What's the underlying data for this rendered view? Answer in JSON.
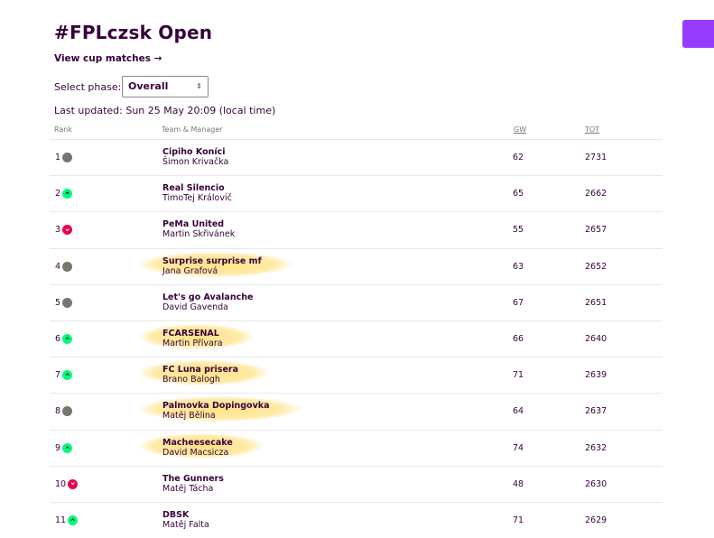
{
  "page": {
    "title": "#FPLczsk Open",
    "cup_link": "View cup matches →",
    "phase_label": "Select phase:",
    "phase_value": "Overall",
    "last_updated": "Last updated: Sun 25 May 20:09 (local time)"
  },
  "colors": {
    "primary": "#37003c",
    "accent": "#963cff",
    "up": "#01fc7a",
    "down": "#e90052",
    "same": "#76766f",
    "highlight": "#ffdd6e"
  },
  "table": {
    "headers": {
      "rank": "Rank",
      "team": "Team & Manager",
      "gw": "GW",
      "tot": "TOT"
    },
    "rows": [
      {
        "rank": "1",
        "movement": "same",
        "team": "Cipiho Koníci",
        "manager": "Šimon Krivačka",
        "gw": "62",
        "tot": "2731",
        "highlighted": false
      },
      {
        "rank": "2",
        "movement": "up",
        "team": "Real Silencio",
        "manager": "TimoTej Královič",
        "gw": "65",
        "tot": "2662",
        "highlighted": false
      },
      {
        "rank": "3",
        "movement": "down",
        "team": "PeMa United",
        "manager": "Martin Skřivánek",
        "gw": "55",
        "tot": "2657",
        "highlighted": false
      },
      {
        "rank": "4",
        "movement": "same",
        "team": "Surprise surprise mf",
        "manager": "Jana Grafová",
        "gw": "63",
        "tot": "2652",
        "highlighted": true
      },
      {
        "rank": "5",
        "movement": "same",
        "team": "Let's go Avalanche",
        "manager": "David Gavenda",
        "gw": "67",
        "tot": "2651",
        "highlighted": false
      },
      {
        "rank": "6",
        "movement": "up",
        "team": "FCARSENAL",
        "manager": "Martin Přívara",
        "gw": "66",
        "tot": "2640",
        "highlighted": true
      },
      {
        "rank": "7",
        "movement": "up",
        "team": "FC Luna prisera",
        "manager": "Brano Balogh",
        "gw": "71",
        "tot": "2639",
        "highlighted": true
      },
      {
        "rank": "8",
        "movement": "same",
        "team": "Palmovka Dopingovka",
        "manager": "Matěj Bělina",
        "gw": "64",
        "tot": "2637",
        "highlighted": true
      },
      {
        "rank": "9",
        "movement": "up",
        "team": "Macheesecake",
        "manager": "David Macsicza",
        "gw": "74",
        "tot": "2632",
        "highlighted": true
      },
      {
        "rank": "10",
        "movement": "down",
        "team": "The Gunners",
        "manager": "Matěj Tácha",
        "gw": "48",
        "tot": "2630",
        "highlighted": false
      },
      {
        "rank": "11",
        "movement": "up",
        "team": "DBSK",
        "manager": "Matěj Falta",
        "gw": "71",
        "tot": "2629",
        "highlighted": false
      }
    ]
  }
}
